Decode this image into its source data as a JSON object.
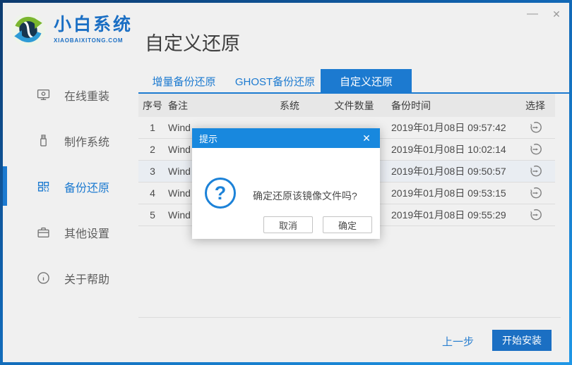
{
  "window": {
    "minimize_icon": "—",
    "close_icon": "✕"
  },
  "brand": {
    "name": "小白系统",
    "domain": "XIAOBAIXITONG.COM"
  },
  "sidebar": {
    "items": [
      {
        "label": "在线重装",
        "icon": "monitor-icon",
        "active": false
      },
      {
        "label": "制作系统",
        "icon": "usb-drive-icon",
        "active": false
      },
      {
        "label": "备份还原",
        "icon": "backup-squares-icon",
        "active": true
      },
      {
        "label": "其他设置",
        "icon": "briefcase-icon",
        "active": false
      },
      {
        "label": "关于帮助",
        "icon": "info-icon",
        "active": false
      }
    ]
  },
  "page": {
    "title": "自定义还原"
  },
  "tabs": [
    {
      "label": "增量备份还原",
      "active": false
    },
    {
      "label": "GHOST备份还原",
      "active": false
    },
    {
      "label": "自定义还原",
      "active": true
    }
  ],
  "table": {
    "headers": [
      "序号",
      "备注",
      "系统",
      "文件数量",
      "备份时间",
      "选择"
    ],
    "rows": [
      {
        "seq": "1",
        "remark": "Wind",
        "time": "2019年01月08日 09:57:42",
        "select_icon": "restore-icon"
      },
      {
        "seq": "2",
        "remark": "Wind",
        "time": "2019年01月08日 10:02:14",
        "select_icon": "restore-icon"
      },
      {
        "seq": "3",
        "remark": "Wind",
        "time": "2019年01月08日 09:50:57",
        "select_icon": "restore-icon",
        "highlighted": true
      },
      {
        "seq": "4",
        "remark": "Wind",
        "time": "2019年01月08日 09:53:15",
        "select_icon": "restore-icon"
      },
      {
        "seq": "5",
        "remark": "Wind",
        "time": "2019年01月08日 09:55:29",
        "select_icon": "restore-icon"
      }
    ]
  },
  "dialog": {
    "title": "提示",
    "close_icon": "✕",
    "question_mark": "?",
    "message": "确定还原该镜像文件吗?",
    "cancel_label": "取消",
    "ok_label": "确定"
  },
  "footer": {
    "back_label": "上一步",
    "install_label": "开始安装"
  },
  "colors": {
    "accent_blue": "#1c7ad0",
    "dialog_header_blue": "#1888de",
    "install_button_blue": "#1b6fc3",
    "frame_border_blue": "#1166b4"
  }
}
